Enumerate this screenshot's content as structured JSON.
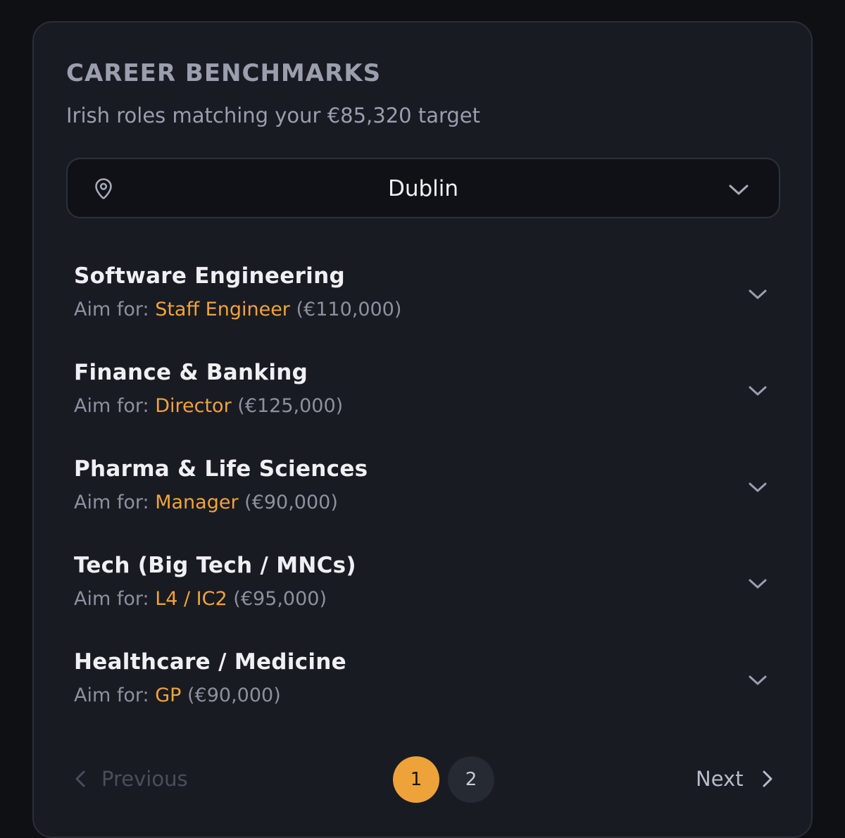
{
  "card": {
    "title": "CAREER BENCHMARKS",
    "subtitle": "Irish roles matching your €85,320 target"
  },
  "location": {
    "icon": "map-pin-icon",
    "value": "Dublin",
    "chevron_icon": "chevron-down-icon"
  },
  "benchmarks": [
    {
      "title": "Software Engineering",
      "aim_prefix": "Aim for:",
      "role": "Staff Engineer",
      "salary": "(€110,000)"
    },
    {
      "title": "Finance & Banking",
      "aim_prefix": "Aim for:",
      "role": "Director",
      "salary": "(€125,000)"
    },
    {
      "title": "Pharma & Life Sciences",
      "aim_prefix": "Aim for:",
      "role": "Manager",
      "salary": "(€90,000)"
    },
    {
      "title": "Tech (Big Tech / MNCs)",
      "aim_prefix": "Aim for:",
      "role": "L4 / IC2",
      "salary": "(€95,000)"
    },
    {
      "title": "Healthcare / Medicine",
      "aim_prefix": "Aim for:",
      "role": "GP",
      "salary": "(€90,000)"
    }
  ],
  "pagination": {
    "previous_label": "Previous",
    "next_label": "Next",
    "pages": [
      "1",
      "2"
    ],
    "current_page": "1"
  },
  "colors": {
    "accent": "#eea23a",
    "card_background": "#181b22",
    "page_background": "#0f1014"
  }
}
